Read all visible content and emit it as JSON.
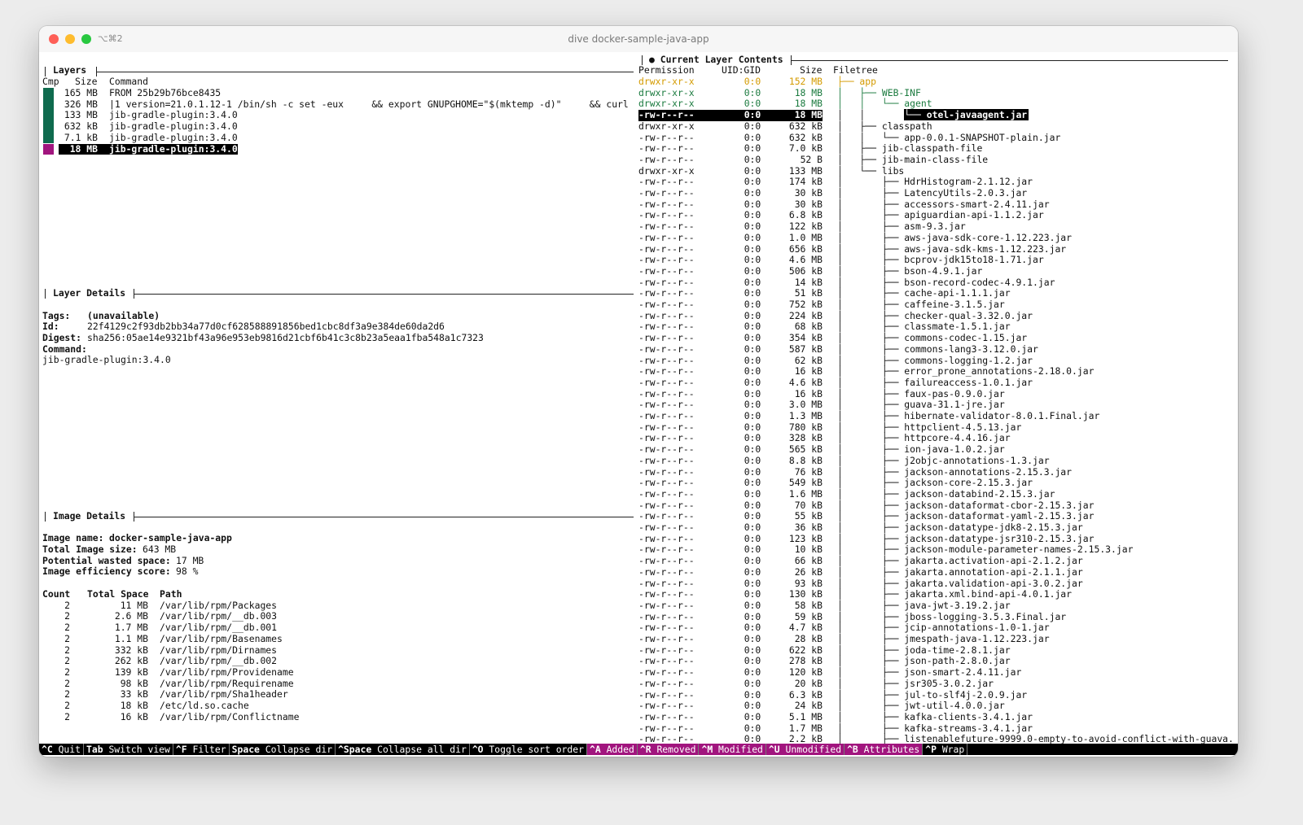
{
  "window": {
    "tab_shortcut": "⌥⌘2",
    "title": "dive docker-sample-java-app"
  },
  "layers": {
    "title": "Layers",
    "headers": {
      "cmp": "Cmp",
      "size": "Size",
      "command": "Command"
    },
    "rows": [
      {
        "size": "165 MB",
        "command": "FROM 25b29b76bce8435"
      },
      {
        "size": "326 MB",
        "command": "|1 version=21.0.1.12-1 /bin/sh -c set -eux     && export GNUPGHOME=\"$(mktemp -d)\"     && curl"
      },
      {
        "size": "133 MB",
        "command": "jib-gradle-plugin:3.4.0"
      },
      {
        "size": "632 kB",
        "command": "jib-gradle-plugin:3.4.0"
      },
      {
        "size": "7.1 kB",
        "command": "jib-gradle-plugin:3.4.0"
      },
      {
        "size": "18 MB",
        "command": "jib-gradle-plugin:3.4.0"
      }
    ],
    "selected_index": 5
  },
  "layer_details": {
    "title": "Layer Details",
    "tags_label": "Tags:",
    "tags_value": "(unavailable)",
    "id_label": "Id:",
    "id_value": "22f4129c2f93db2bb34a77d0cf628588891856bed1cbc8df3a9e384de60da2d6",
    "digest_label": "Digest:",
    "digest_value": "sha256:05ae14e9321bf43a96e953eb9816d21cbf6b41c3c8b23a5eaa1fba548a1c7323",
    "command_label": "Command:",
    "command_value": "jib-gradle-plugin:3.4.0"
  },
  "image_details": {
    "title": "Image Details",
    "name_label": "Image name:",
    "name_value": "docker-sample-java-app",
    "total_label": "Total Image size:",
    "total_value": "643 MB",
    "wasted_label": "Potential wasted space:",
    "wasted_value": "17 MB",
    "efficiency_label": "Image efficiency score:",
    "efficiency_value": "98 %",
    "headers": {
      "count": "Count",
      "total": "Total Space",
      "path": "Path"
    },
    "rows": [
      {
        "count": "2",
        "total": "11 MB",
        "path": "/var/lib/rpm/Packages"
      },
      {
        "count": "2",
        "total": "2.6 MB",
        "path": "/var/lib/rpm/__db.003"
      },
      {
        "count": "2",
        "total": "1.7 MB",
        "path": "/var/lib/rpm/__db.001"
      },
      {
        "count": "2",
        "total": "1.1 MB",
        "path": "/var/lib/rpm/Basenames"
      },
      {
        "count": "2",
        "total": "332 kB",
        "path": "/var/lib/rpm/Dirnames"
      },
      {
        "count": "2",
        "total": "262 kB",
        "path": "/var/lib/rpm/__db.002"
      },
      {
        "count": "2",
        "total": "139 kB",
        "path": "/var/lib/rpm/Providename"
      },
      {
        "count": "2",
        "total": "98 kB",
        "path": "/var/lib/rpm/Requirename"
      },
      {
        "count": "2",
        "total": "33 kB",
        "path": "/var/lib/rpm/Sha1header"
      },
      {
        "count": "2",
        "total": "18 kB",
        "path": "/etc/ld.so.cache"
      },
      {
        "count": "2",
        "total": "16 kB",
        "path": "/var/lib/rpm/Conflictname"
      }
    ]
  },
  "contents": {
    "title": "● Current Layer Contents",
    "headers": {
      "permission": "Permission",
      "uid": "UID:GID",
      "size": "Size",
      "filetree": "Filetree"
    },
    "rows": [
      {
        "perm": "drwxr-xr-x",
        "uid": "0:0",
        "size": "152 MB",
        "tree": "├── app",
        "color": "yellow"
      },
      {
        "perm": "drwxr-xr-x",
        "uid": "0:0",
        "size": "18 MB",
        "tree": "│   ├── WEB-INF",
        "color": "green"
      },
      {
        "perm": "drwxr-xr-x",
        "uid": "0:0",
        "size": "18 MB",
        "tree": "│   │   └── agent",
        "color": "green"
      },
      {
        "perm": "-rw-r--r--",
        "uid": "0:0",
        "size": "18 MB",
        "tree": "│   │       └── otel-javaagent.jar",
        "color": "selected"
      },
      {
        "perm": "drwxr-xr-x",
        "uid": "0:0",
        "size": "632 kB",
        "tree": "│   ├── classpath",
        "color": ""
      },
      {
        "perm": "-rw-r--r--",
        "uid": "0:0",
        "size": "632 kB",
        "tree": "│   │   └── app-0.0.1-SNAPSHOT-plain.jar",
        "color": ""
      },
      {
        "perm": "-rw-r--r--",
        "uid": "0:0",
        "size": "7.0 kB",
        "tree": "│   ├── jib-classpath-file",
        "color": ""
      },
      {
        "perm": "-rw-r--r--",
        "uid": "0:0",
        "size": "52 B",
        "tree": "│   ├── jib-main-class-file",
        "color": ""
      },
      {
        "perm": "drwxr-xr-x",
        "uid": "0:0",
        "size": "133 MB",
        "tree": "│   └── libs",
        "color": ""
      },
      {
        "perm": "-rw-r--r--",
        "uid": "0:0",
        "size": "174 kB",
        "tree": "│       ├── HdrHistogram-2.1.12.jar",
        "color": ""
      },
      {
        "perm": "-rw-r--r--",
        "uid": "0:0",
        "size": "30 kB",
        "tree": "│       ├── LatencyUtils-2.0.3.jar",
        "color": ""
      },
      {
        "perm": "-rw-r--r--",
        "uid": "0:0",
        "size": "30 kB",
        "tree": "│       ├── accessors-smart-2.4.11.jar",
        "color": ""
      },
      {
        "perm": "-rw-r--r--",
        "uid": "0:0",
        "size": "6.8 kB",
        "tree": "│       ├── apiguardian-api-1.1.2.jar",
        "color": ""
      },
      {
        "perm": "-rw-r--r--",
        "uid": "0:0",
        "size": "122 kB",
        "tree": "│       ├── asm-9.3.jar",
        "color": ""
      },
      {
        "perm": "-rw-r--r--",
        "uid": "0:0",
        "size": "1.0 MB",
        "tree": "│       ├── aws-java-sdk-core-1.12.223.jar",
        "color": ""
      },
      {
        "perm": "-rw-r--r--",
        "uid": "0:0",
        "size": "656 kB",
        "tree": "│       ├── aws-java-sdk-kms-1.12.223.jar",
        "color": ""
      },
      {
        "perm": "-rw-r--r--",
        "uid": "0:0",
        "size": "4.6 MB",
        "tree": "│       ├── bcprov-jdk15to18-1.71.jar",
        "color": ""
      },
      {
        "perm": "-rw-r--r--",
        "uid": "0:0",
        "size": "506 kB",
        "tree": "│       ├── bson-4.9.1.jar",
        "color": ""
      },
      {
        "perm": "-rw-r--r--",
        "uid": "0:0",
        "size": "14 kB",
        "tree": "│       ├── bson-record-codec-4.9.1.jar",
        "color": ""
      },
      {
        "perm": "-rw-r--r--",
        "uid": "0:0",
        "size": "51 kB",
        "tree": "│       ├── cache-api-1.1.1.jar",
        "color": ""
      },
      {
        "perm": "-rw-r--r--",
        "uid": "0:0",
        "size": "752 kB",
        "tree": "│       ├── caffeine-3.1.5.jar",
        "color": ""
      },
      {
        "perm": "-rw-r--r--",
        "uid": "0:0",
        "size": "224 kB",
        "tree": "│       ├── checker-qual-3.32.0.jar",
        "color": ""
      },
      {
        "perm": "-rw-r--r--",
        "uid": "0:0",
        "size": "68 kB",
        "tree": "│       ├── classmate-1.5.1.jar",
        "color": ""
      },
      {
        "perm": "-rw-r--r--",
        "uid": "0:0",
        "size": "354 kB",
        "tree": "│       ├── commons-codec-1.15.jar",
        "color": ""
      },
      {
        "perm": "-rw-r--r--",
        "uid": "0:0",
        "size": "587 kB",
        "tree": "│       ├── commons-lang3-3.12.0.jar",
        "color": ""
      },
      {
        "perm": "-rw-r--r--",
        "uid": "0:0",
        "size": "62 kB",
        "tree": "│       ├── commons-logging-1.2.jar",
        "color": ""
      },
      {
        "perm": "-rw-r--r--",
        "uid": "0:0",
        "size": "16 kB",
        "tree": "│       ├── error_prone_annotations-2.18.0.jar",
        "color": ""
      },
      {
        "perm": "-rw-r--r--",
        "uid": "0:0",
        "size": "4.6 kB",
        "tree": "│       ├── failureaccess-1.0.1.jar",
        "color": ""
      },
      {
        "perm": "-rw-r--r--",
        "uid": "0:0",
        "size": "16 kB",
        "tree": "│       ├── faux-pas-0.9.0.jar",
        "color": ""
      },
      {
        "perm": "-rw-r--r--",
        "uid": "0:0",
        "size": "3.0 MB",
        "tree": "│       ├── guava-31.1-jre.jar",
        "color": ""
      },
      {
        "perm": "-rw-r--r--",
        "uid": "0:0",
        "size": "1.3 MB",
        "tree": "│       ├── hibernate-validator-8.0.1.Final.jar",
        "color": ""
      },
      {
        "perm": "-rw-r--r--",
        "uid": "0:0",
        "size": "780 kB",
        "tree": "│       ├── httpclient-4.5.13.jar",
        "color": ""
      },
      {
        "perm": "-rw-r--r--",
        "uid": "0:0",
        "size": "328 kB",
        "tree": "│       ├── httpcore-4.4.16.jar",
        "color": ""
      },
      {
        "perm": "-rw-r--r--",
        "uid": "0:0",
        "size": "565 kB",
        "tree": "│       ├── ion-java-1.0.2.jar",
        "color": ""
      },
      {
        "perm": "-rw-r--r--",
        "uid": "0:0",
        "size": "8.8 kB",
        "tree": "│       ├── j2objc-annotations-1.3.jar",
        "color": ""
      },
      {
        "perm": "-rw-r--r--",
        "uid": "0:0",
        "size": "76 kB",
        "tree": "│       ├── jackson-annotations-2.15.3.jar",
        "color": ""
      },
      {
        "perm": "-rw-r--r--",
        "uid": "0:0",
        "size": "549 kB",
        "tree": "│       ├── jackson-core-2.15.3.jar",
        "color": ""
      },
      {
        "perm": "-rw-r--r--",
        "uid": "0:0",
        "size": "1.6 MB",
        "tree": "│       ├── jackson-databind-2.15.3.jar",
        "color": ""
      },
      {
        "perm": "-rw-r--r--",
        "uid": "0:0",
        "size": "70 kB",
        "tree": "│       ├── jackson-dataformat-cbor-2.15.3.jar",
        "color": ""
      },
      {
        "perm": "-rw-r--r--",
        "uid": "0:0",
        "size": "55 kB",
        "tree": "│       ├── jackson-dataformat-yaml-2.15.3.jar",
        "color": ""
      },
      {
        "perm": "-rw-r--r--",
        "uid": "0:0",
        "size": "36 kB",
        "tree": "│       ├── jackson-datatype-jdk8-2.15.3.jar",
        "color": ""
      },
      {
        "perm": "-rw-r--r--",
        "uid": "0:0",
        "size": "123 kB",
        "tree": "│       ├── jackson-datatype-jsr310-2.15.3.jar",
        "color": ""
      },
      {
        "perm": "-rw-r--r--",
        "uid": "0:0",
        "size": "10 kB",
        "tree": "│       ├── jackson-module-parameter-names-2.15.3.jar",
        "color": ""
      },
      {
        "perm": "-rw-r--r--",
        "uid": "0:0",
        "size": "66 kB",
        "tree": "│       ├── jakarta.activation-api-2.1.2.jar",
        "color": ""
      },
      {
        "perm": "-rw-r--r--",
        "uid": "0:0",
        "size": "26 kB",
        "tree": "│       ├── jakarta.annotation-api-2.1.1.jar",
        "color": ""
      },
      {
        "perm": "-rw-r--r--",
        "uid": "0:0",
        "size": "93 kB",
        "tree": "│       ├── jakarta.validation-api-3.0.2.jar",
        "color": ""
      },
      {
        "perm": "-rw-r--r--",
        "uid": "0:0",
        "size": "130 kB",
        "tree": "│       ├── jakarta.xml.bind-api-4.0.1.jar",
        "color": ""
      },
      {
        "perm": "-rw-r--r--",
        "uid": "0:0",
        "size": "58 kB",
        "tree": "│       ├── java-jwt-3.19.2.jar",
        "color": ""
      },
      {
        "perm": "-rw-r--r--",
        "uid": "0:0",
        "size": "59 kB",
        "tree": "│       ├── jboss-logging-3.5.3.Final.jar",
        "color": ""
      },
      {
        "perm": "-rw-r--r--",
        "uid": "0:0",
        "size": "4.7 kB",
        "tree": "│       ├── jcip-annotations-1.0-1.jar",
        "color": ""
      },
      {
        "perm": "-rw-r--r--",
        "uid": "0:0",
        "size": "28 kB",
        "tree": "│       ├── jmespath-java-1.12.223.jar",
        "color": ""
      },
      {
        "perm": "-rw-r--r--",
        "uid": "0:0",
        "size": "622 kB",
        "tree": "│       ├── joda-time-2.8.1.jar",
        "color": ""
      },
      {
        "perm": "-rw-r--r--",
        "uid": "0:0",
        "size": "278 kB",
        "tree": "│       ├── json-path-2.8.0.jar",
        "color": ""
      },
      {
        "perm": "-rw-r--r--",
        "uid": "0:0",
        "size": "120 kB",
        "tree": "│       ├── json-smart-2.4.11.jar",
        "color": ""
      },
      {
        "perm": "-rw-r--r--",
        "uid": "0:0",
        "size": "20 kB",
        "tree": "│       ├── jsr305-3.0.2.jar",
        "color": ""
      },
      {
        "perm": "-rw-r--r--",
        "uid": "0:0",
        "size": "6.3 kB",
        "tree": "│       ├── jul-to-slf4j-2.0.9.jar",
        "color": ""
      },
      {
        "perm": "-rw-r--r--",
        "uid": "0:0",
        "size": "24 kB",
        "tree": "│       ├── jwt-util-4.0.0.jar",
        "color": ""
      },
      {
        "perm": "-rw-r--r--",
        "uid": "0:0",
        "size": "5.1 MB",
        "tree": "│       ├── kafka-clients-3.4.1.jar",
        "color": ""
      },
      {
        "perm": "-rw-r--r--",
        "uid": "0:0",
        "size": "1.7 MB",
        "tree": "│       ├── kafka-streams-3.4.1.jar",
        "color": ""
      },
      {
        "perm": "-rw-r--r--",
        "uid": "0:0",
        "size": "2.2 kB",
        "tree": "│       ├── listenablefuture-9999.0-empty-to-avoid-conflict-with-guava.",
        "color": ""
      },
      {
        "perm": "-rw-r--r--",
        "uid": "0:0",
        "size": "",
        "tree": "",
        "color": ""
      }
    ]
  },
  "statusbar": {
    "items": [
      {
        "key": "^C",
        "label": "Quit",
        "magenta": false
      },
      {
        "key": "Tab",
        "label": "Switch view",
        "magenta": false
      },
      {
        "key": "^F",
        "label": "Filter",
        "magenta": false
      },
      {
        "key": "Space",
        "label": "Collapse dir",
        "magenta": false
      },
      {
        "key": "^Space",
        "label": "Collapse all dir",
        "magenta": false
      },
      {
        "key": "^O",
        "label": "Toggle sort order",
        "magenta": false
      },
      {
        "key": "^A",
        "label": "Added",
        "magenta": true
      },
      {
        "key": "^R",
        "label": "Removed",
        "magenta": true
      },
      {
        "key": "^M",
        "label": "Modified",
        "magenta": true
      },
      {
        "key": "^U",
        "label": "Unmodified",
        "magenta": true
      },
      {
        "key": "^B",
        "label": "Attributes",
        "magenta": true
      },
      {
        "key": "^P",
        "label": "Wrap",
        "magenta": false
      }
    ]
  },
  "colors": {
    "cmp_green": "#0f6b4e",
    "cmp_magenta": "#a1157e",
    "tree_green": "#1a7a3e",
    "tree_yellow": "#d49b00"
  }
}
